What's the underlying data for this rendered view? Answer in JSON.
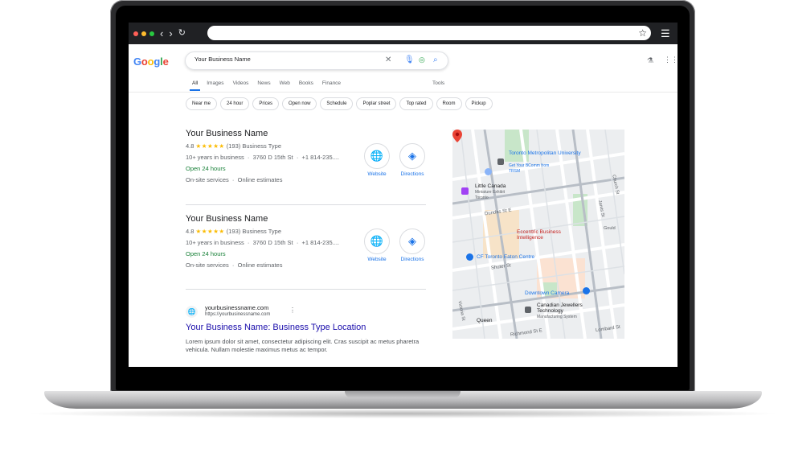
{
  "browser": {
    "url": "",
    "star_icon": "star-icon",
    "menu_icon": "menu-icon"
  },
  "google": {
    "logo": "Google",
    "search_query": "Your Business Name",
    "tabs": [
      "All",
      "Images",
      "Videos",
      "News",
      "Web",
      "Books",
      "Finance"
    ],
    "tools": "Tools",
    "chips": [
      "Near me",
      "24 hour",
      "Prices",
      "Open now",
      "Schedule",
      "Poplar street",
      "Top rated",
      "Room",
      "Pickup"
    ]
  },
  "listings": [
    {
      "name": "Your Business Name",
      "rating": "4.8",
      "stars": "★★★★★",
      "reviews": "(193)",
      "type": "Business Type",
      "years": "10+ years in business",
      "address": "3760 D 15th St",
      "phone": "+1 814-235....",
      "hours": "Open 24 hours",
      "services": "On-site services",
      "estimates": "Online estimates",
      "website": "Website",
      "directions": "Directions"
    },
    {
      "name": "Your Business Name",
      "rating": "4.8",
      "stars": "★★★★★",
      "reviews": "(193)",
      "type": "Business Type",
      "years": "10+ years in business",
      "address": "3760 D 15th St",
      "phone": "+1 814-235....",
      "hours": "Open 24 hours",
      "services": "On-site services",
      "estimates": "Online estimates",
      "website": "Website",
      "directions": "Directions"
    }
  ],
  "organic": {
    "site_name": "yourbusinessname.com",
    "site_url": "https://yourbusinessname.com",
    "title": "Your Business Name: Business Type Location",
    "snippet": "Lorem ipsum dolor sit amet, consectetur adipiscing elit. Cras suscipit ac metus pharetra vehicula. Nullam molestie maximus metus ac tempor."
  },
  "map": {
    "labels": {
      "university": "Toronto Metropolitan University",
      "university_sub": "Get Your BComm from TRSM",
      "little_canada": "Little Canada",
      "little_canada_sub": "Miniature Exhibit Toronto",
      "dundas": "Dundas St E",
      "business": "Eccentric Business Intelligence",
      "eaton": "CF Toronto Eaton Centre",
      "shuter": "Shuter St",
      "downtown": "Downtown Camera",
      "jewellers": "Canadian Jewellers Technology",
      "jewellers_sub": "Manufacturing System",
      "queen": "Queen",
      "richmond": "Richmond St E",
      "lombard": "Lombard St",
      "jarvis": "Jarvis St",
      "victoria": "Victoria St",
      "church": "Church St",
      "gould": "Gould"
    },
    "colors": {
      "park": "#c8e6c9",
      "blue": "#1a73e8",
      "pin": "#ea4335",
      "mall": "#fbe2d2"
    }
  }
}
